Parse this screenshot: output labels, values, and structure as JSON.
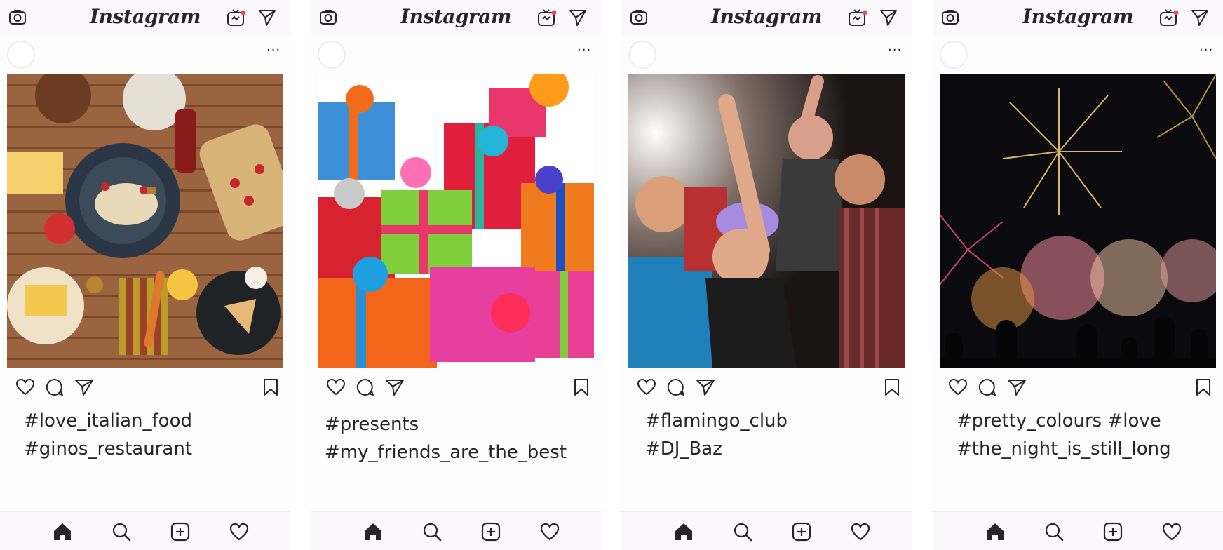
{
  "app": {
    "logo_text": "Instagram",
    "header_icons": [
      "camera-icon",
      "igtv-icon",
      "direct-message-icon"
    ],
    "post_icons": [
      "more-options-icon",
      "heart-icon",
      "comment-icon",
      "share-icon",
      "bookmark-icon"
    ],
    "nav_icons": [
      "home-icon",
      "search-icon",
      "new-post-icon",
      "activity-heart-icon"
    ],
    "accent_notification": "#ed4956"
  },
  "posts": [
    {
      "more_label": "...",
      "photo": "food-spread-photo",
      "caption": [
        "#love_italian_food",
        "#ginos_restaurant"
      ]
    },
    {
      "more_label": "...",
      "photo": "gift-boxes-photo",
      "caption": [
        "#presents",
        "#my_friends_are_the_best"
      ]
    },
    {
      "more_label": "...",
      "photo": "dancing-party-photo",
      "caption": [
        "#flamingo_club",
        "#DJ_Baz"
      ]
    },
    {
      "more_label": "...",
      "photo": "fireworks-photo",
      "caption": [
        "#pretty_colours #love",
        "#the_night_is_still_long"
      ]
    }
  ]
}
